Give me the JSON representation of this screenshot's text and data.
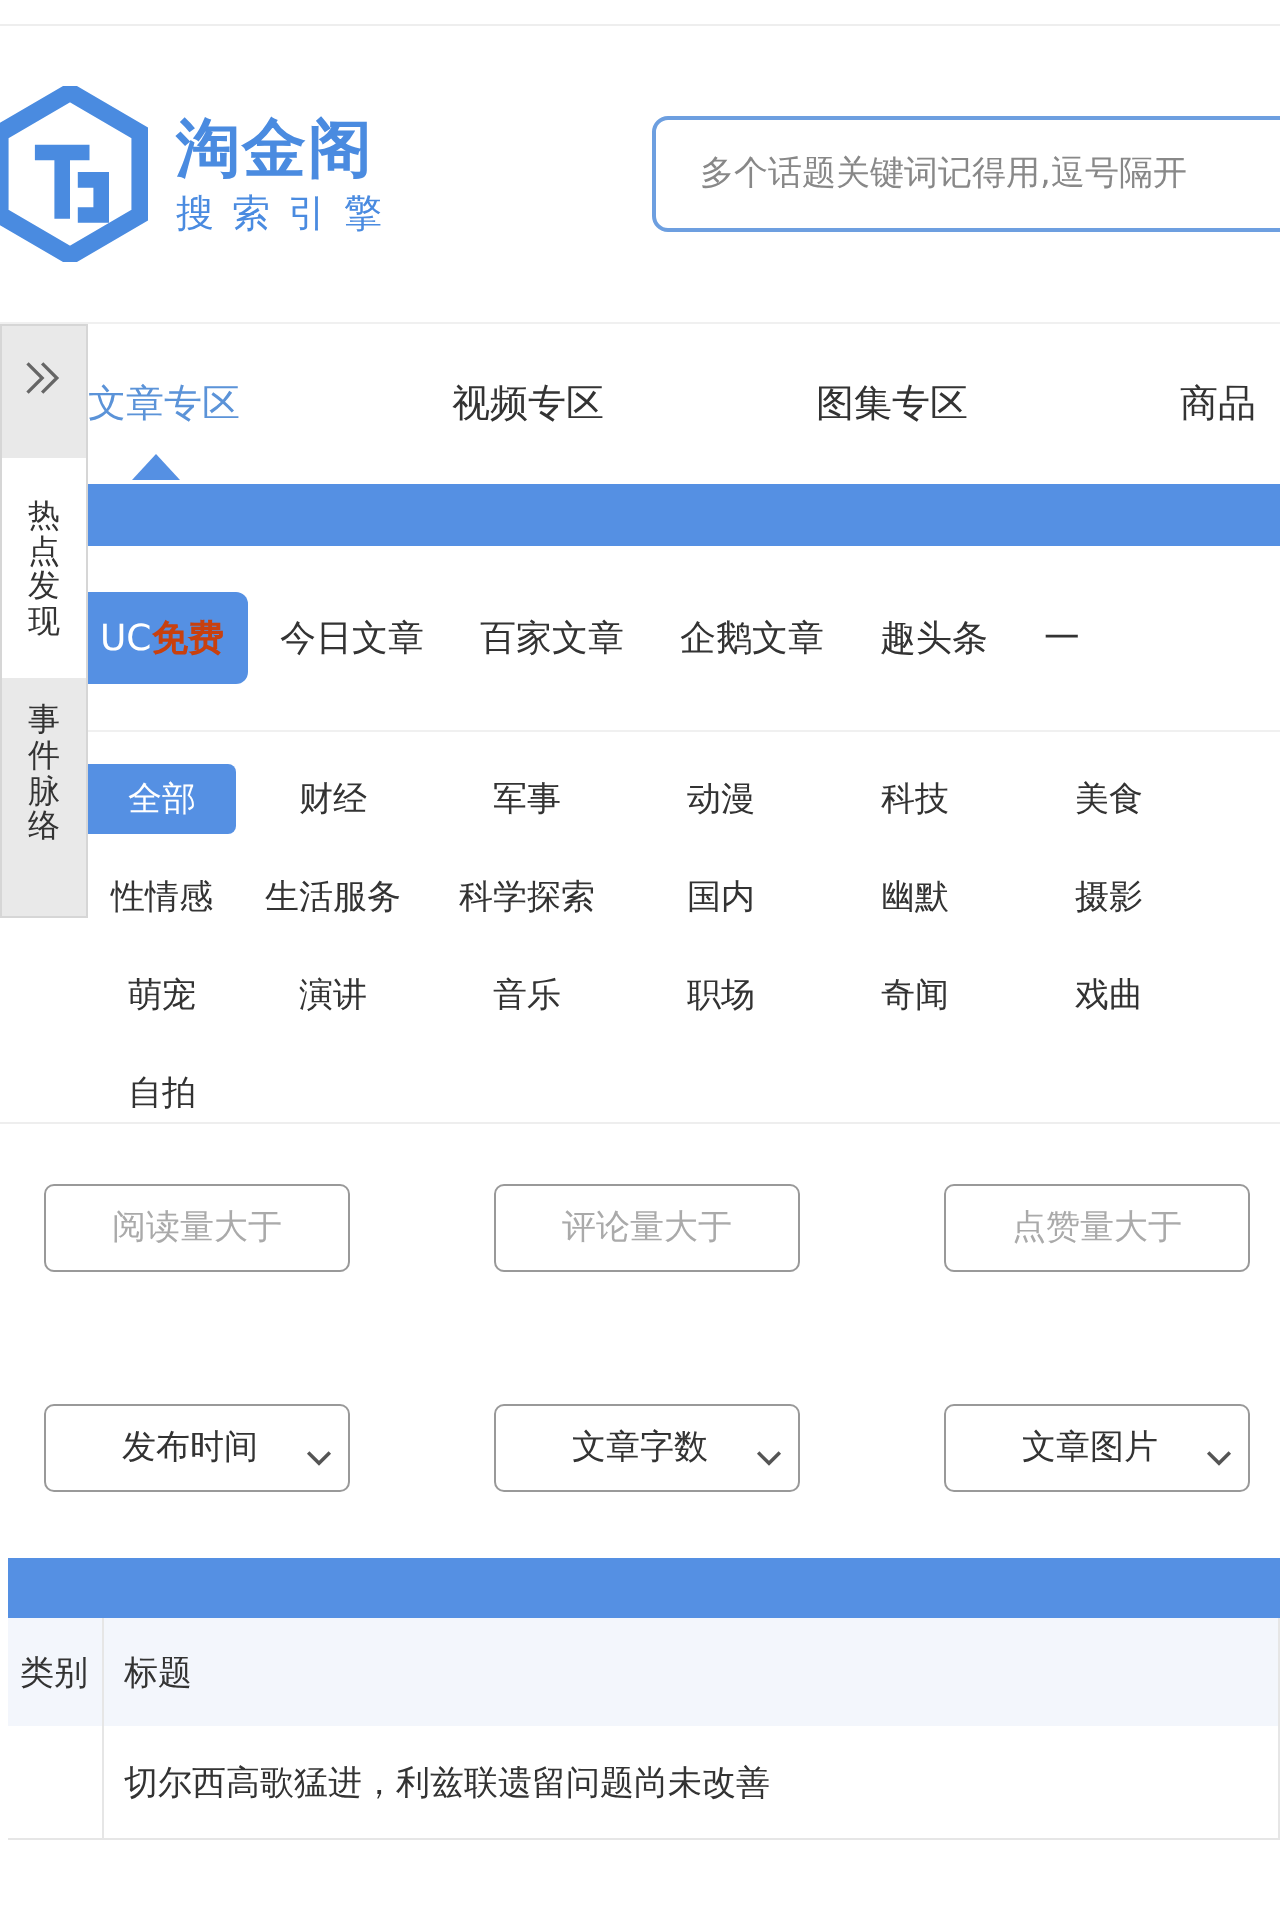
{
  "logo": {
    "title": "淘金阁",
    "subtitle": "搜索引擎"
  },
  "search": {
    "placeholder": "多个话题关键词记得用,逗号隔开"
  },
  "sidebar": {
    "items": [
      {
        "label": "热点发现",
        "selected": true
      },
      {
        "label": "事件脉络",
        "selected": false
      }
    ]
  },
  "tabs": [
    {
      "label": "文章专区",
      "selected": true
    },
    {
      "label": "视频专区",
      "selected": false
    },
    {
      "label": "图集专区",
      "selected": false
    },
    {
      "label": "商品",
      "selected": false
    }
  ],
  "sources": [
    {
      "label": "UC",
      "badge": "免费",
      "selected": true
    },
    {
      "label": "今日文章",
      "selected": false
    },
    {
      "label": "百家文章",
      "selected": false
    },
    {
      "label": "企鹅文章",
      "selected": false
    },
    {
      "label": "趣头条",
      "selected": false
    },
    {
      "label": "一",
      "selected": false
    }
  ],
  "categories": [
    {
      "label": "全部",
      "selected": true
    },
    {
      "label": "财经",
      "selected": false
    },
    {
      "label": "军事",
      "selected": false
    },
    {
      "label": "动漫",
      "selected": false
    },
    {
      "label": "科技",
      "selected": false
    },
    {
      "label": "美食",
      "selected": false
    },
    {
      "label": "性情感",
      "selected": false
    },
    {
      "label": "生活服务",
      "selected": false
    },
    {
      "label": "科学探索",
      "selected": false
    },
    {
      "label": "国内",
      "selected": false
    },
    {
      "label": "幽默",
      "selected": false
    },
    {
      "label": "摄影",
      "selected": false
    },
    {
      "label": "萌宠",
      "selected": false
    },
    {
      "label": "演讲",
      "selected": false
    },
    {
      "label": "音乐",
      "selected": false
    },
    {
      "label": "职场",
      "selected": false
    },
    {
      "label": "奇闻",
      "selected": false
    },
    {
      "label": "戏曲",
      "selected": false
    },
    {
      "label": "自拍",
      "selected": false
    }
  ],
  "filters": [
    {
      "kind": "input",
      "placeholder": "阅读量大于"
    },
    {
      "kind": "input",
      "placeholder": "评论量大于"
    },
    {
      "kind": "input",
      "placeholder": "点赞量大于"
    },
    {
      "kind": "select",
      "label": "发布时间"
    },
    {
      "kind": "select",
      "label": "文章字数"
    },
    {
      "kind": "select",
      "label": "文章图片"
    }
  ],
  "table": {
    "columns": [
      "类别",
      "标题"
    ],
    "rows": [
      {
        "title": "切尔西高歌猛进，利兹联遗留问题尚未改善"
      }
    ]
  }
}
